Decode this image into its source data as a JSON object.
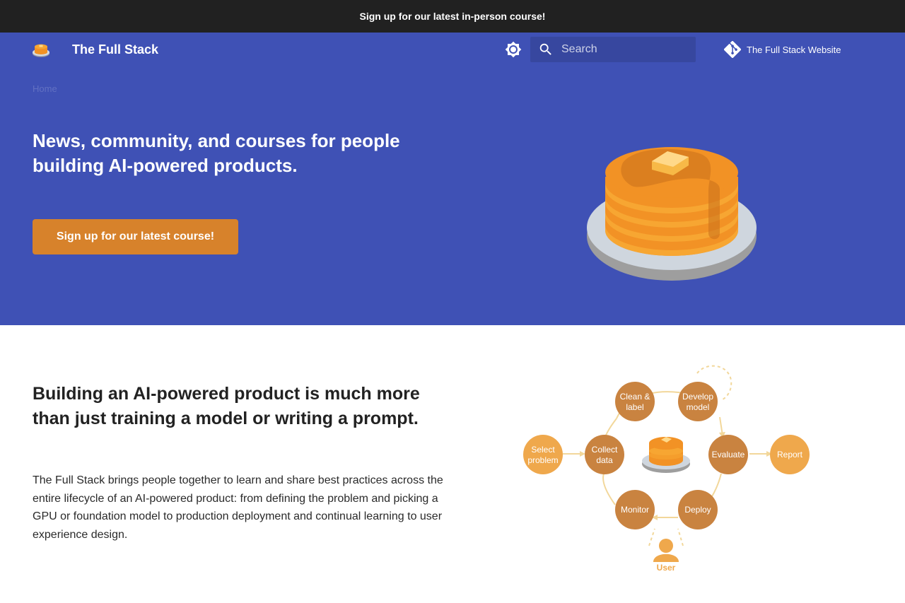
{
  "announcement": "Sign up for our latest in-person course!",
  "header": {
    "site_title": "The Full Stack",
    "search_placeholder": "Search",
    "repo_link": "The Full Stack Website"
  },
  "breadcrumb": "Home",
  "hero": {
    "title": "News, community, and courses for people building AI-powered products.",
    "cta": "Sign up for our latest course!"
  },
  "section": {
    "title": "Building an AI-powered product is much more than just training a model or writing a prompt.",
    "body": "The Full Stack brings people together to learn and share best practices across the entire lifecycle of an AI-powered product: from defining the problem and picking a GPU or foundation model to production deployment and continual learning to user experience design."
  },
  "diagram": {
    "nodes": {
      "clean_label": [
        "Clean &",
        "label"
      ],
      "develop_model": [
        "Develop",
        "model"
      ],
      "select_problem": [
        "Select",
        "problem"
      ],
      "collect_data": [
        "Collect",
        "data"
      ],
      "evaluate": "Evaluate",
      "report": "Report",
      "monitor": "Monitor",
      "deploy": "Deploy",
      "user": "User"
    }
  },
  "colors": {
    "announcement_bg": "#212121",
    "primary": "#3f51b5",
    "accent": "#d7822b",
    "node_dark": "#c98340",
    "node_light": "#efa84c",
    "arrow": "#f2d79a"
  },
  "icons": {
    "logo": "pancake-logo-icon",
    "theme": "brightness-icon",
    "search": "search-icon",
    "repo": "git-icon"
  }
}
